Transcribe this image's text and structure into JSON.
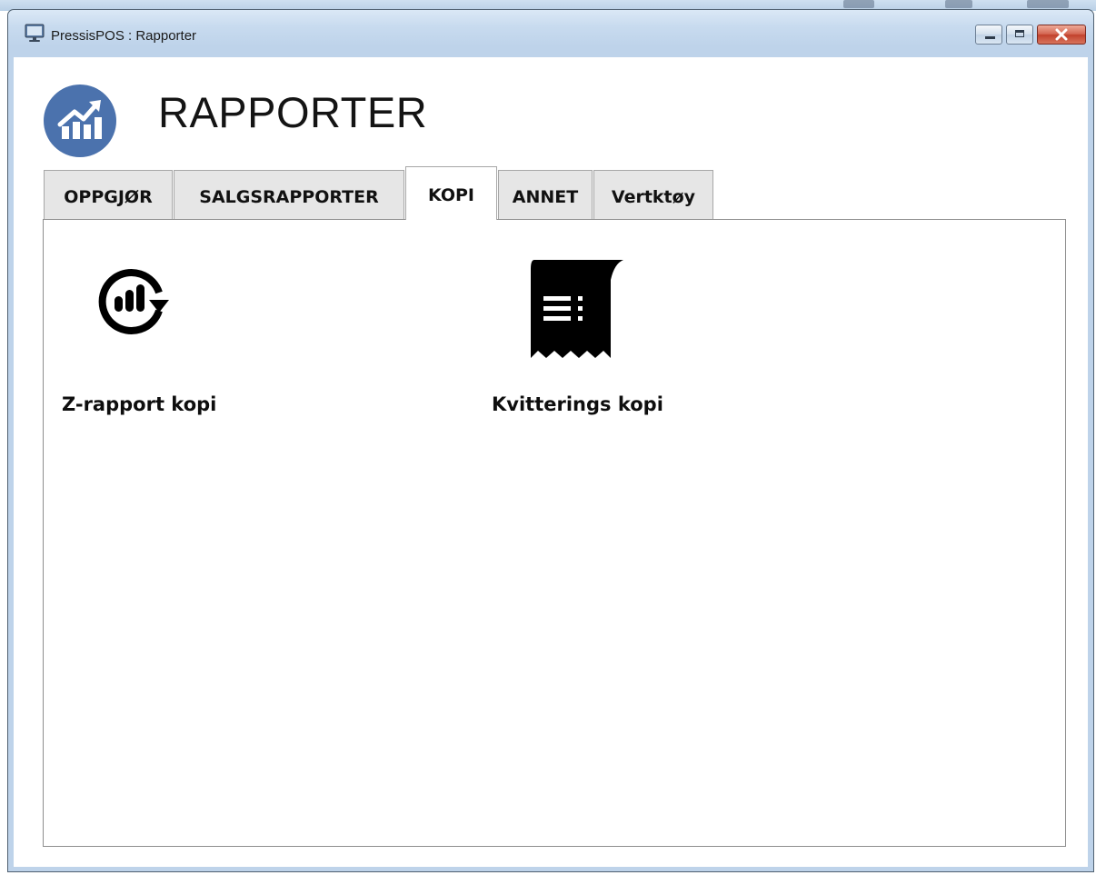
{
  "window": {
    "title": "PressisPOS : Rapporter",
    "buttons": {
      "minimize": "minimize-icon",
      "maximize": "maximize-icon",
      "close": "close-icon"
    }
  },
  "header": {
    "title": "RAPPORTER",
    "logo_icon": "trending-chart-icon",
    "logo_color": "#4b72ad"
  },
  "tabs": [
    {
      "label": "OPPGJØR",
      "active": false
    },
    {
      "label": "SALGSRAPPORTER",
      "active": false
    },
    {
      "label": "KOPI",
      "active": true
    },
    {
      "label": "ANNET",
      "active": false
    },
    {
      "label": "Vertktøy",
      "active": false
    }
  ],
  "tiles": [
    {
      "label": "Z-rapport kopi",
      "icon": "report-refresh-icon"
    },
    {
      "label": "Kvitterings kopi",
      "icon": "receipt-icon"
    }
  ],
  "colors": {
    "titlebar": "#bed3ea",
    "close_button": "#c94b35",
    "tab_inactive": "#e6e6e6",
    "panel_border": "#8e8e8e"
  }
}
